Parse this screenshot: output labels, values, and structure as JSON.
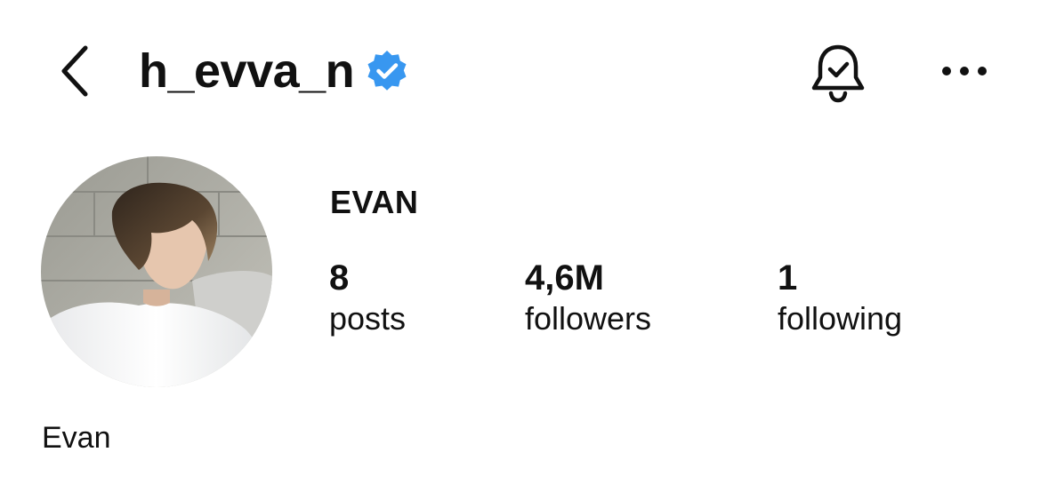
{
  "header": {
    "username": "h_evva_n",
    "verified": true,
    "icons": {
      "back": "chevron-left-icon",
      "verified": "verified-badge-icon",
      "notifications": "bell-check-icon",
      "more": "more-horizontal-icon"
    },
    "verified_color": "#3897f0"
  },
  "profile": {
    "display_name": "EVAN",
    "bio_name": "Evan",
    "stats": {
      "posts": {
        "value": "8",
        "label": "posts"
      },
      "followers": {
        "value": "4,6M",
        "label": "followers"
      },
      "following": {
        "value": "1",
        "label": "following"
      }
    }
  }
}
